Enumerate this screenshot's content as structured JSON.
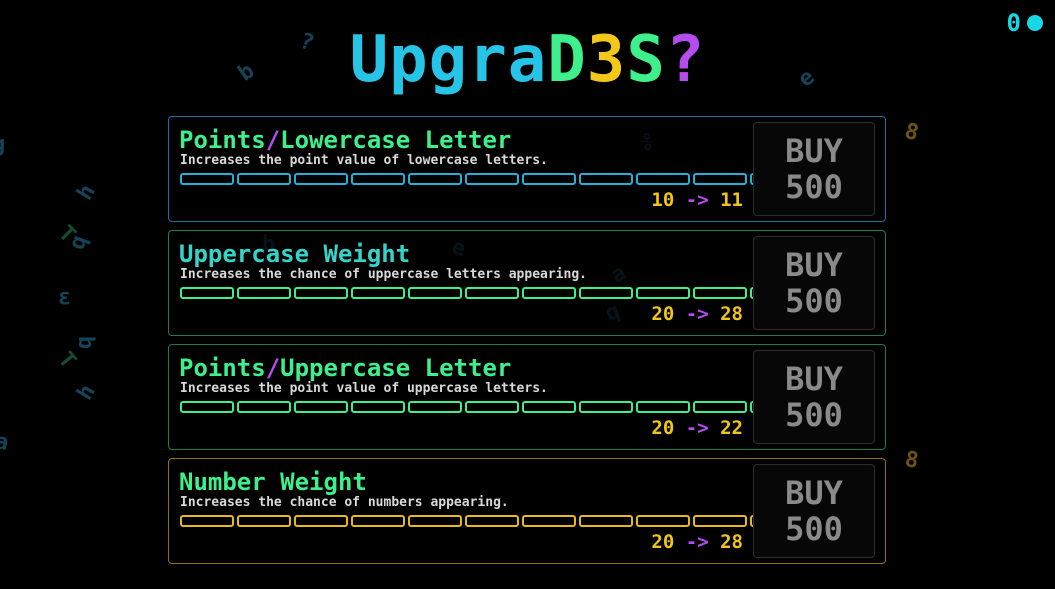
{
  "points": {
    "value": "0",
    "color": "#18d8e8"
  },
  "title": {
    "segments": [
      {
        "text": "Upgra",
        "color": "#26c4e6"
      },
      {
        "text": "D",
        "color": "#3ef08c"
      },
      {
        "text": "3",
        "color": "#f3c81b"
      },
      {
        "text": "S",
        "color": "#3ef08c"
      },
      {
        "text": "?",
        "color": "#b44cf0"
      }
    ]
  },
  "upgrades": [
    {
      "name_parts": [
        {
          "text": "Points",
          "color": "#3ef08c"
        },
        {
          "text": "/",
          "color": "#b44cf0"
        },
        {
          "text": "Lowercase Letter",
          "color": "#3ef08c"
        }
      ],
      "description": "Increases the point value of lowercase letters.",
      "border_color": "#1f6fa0",
      "bar_color": "#26b0d8",
      "level_segments": 11,
      "current_value": "10",
      "arrow": "->",
      "next_value": "11",
      "buy_label": "BUY",
      "cost": "500"
    },
    {
      "name_parts": [
        {
          "text": "Uppercase Weight",
          "color": "#34d4c8"
        }
      ],
      "description": "Increases the chance of uppercase letters appearing.",
      "border_color": "#1f7a5a",
      "bar_color": "#3ef08c",
      "level_segments": 11,
      "current_value": "20",
      "arrow": "->",
      "next_value": "28",
      "buy_label": "BUY",
      "cost": "500"
    },
    {
      "name_parts": [
        {
          "text": "Points",
          "color": "#3ef08c"
        },
        {
          "text": "/",
          "color": "#b44cf0"
        },
        {
          "text": "Uppercase Letter",
          "color": "#3ef08c"
        }
      ],
      "description": "Increases the point value of uppercase letters.",
      "border_color": "#1f7a4a",
      "bar_color": "#3ef08c",
      "level_segments": 11,
      "current_value": "20",
      "arrow": "->",
      "next_value": "22",
      "buy_label": "BUY",
      "cost": "500"
    },
    {
      "name_parts": [
        {
          "text": "Number Weight",
          "color": "#3ef08c"
        }
      ],
      "description": "Increases the chance of numbers appearing.",
      "border_color": "#8a7314",
      "bar_color": "#e8b91a",
      "level_segments": 11,
      "current_value": "20",
      "arrow": "->",
      "next_value": "28",
      "buy_label": "BUY",
      "cost": "500"
    }
  ],
  "background_glyphs": [
    {
      "char": "b",
      "color": "#2a7aa0"
    },
    {
      "char": "?",
      "color": "#2a7aa0"
    },
    {
      "char": "e",
      "color": "#2a7aa0"
    },
    {
      "char": "8",
      "color": "#c89a1a"
    },
    {
      "char": "8",
      "color": "#c89a1a"
    },
    {
      "char": "h",
      "color": "#2a7aa0"
    },
    {
      "char": "T",
      "color": "#2a8a5a"
    },
    {
      "char": "q",
      "color": "#2a7aa0"
    },
    {
      "char": "ε",
      "color": "#2a7aa0"
    },
    {
      "char": "q",
      "color": "#2a7aa0"
    },
    {
      "char": "T",
      "color": "#2a8a5a"
    },
    {
      "char": "h",
      "color": "#2a7aa0"
    },
    {
      "char": "a",
      "color": "#2a7aa0"
    },
    {
      "char": "g",
      "color": "#2a7aa0"
    },
    {
      "char": "%",
      "color": "#7a3aa0"
    },
    {
      "char": "a",
      "color": "#2a7aa0"
    },
    {
      "char": "e",
      "color": "#2a7aa0"
    },
    {
      "char": "q",
      "color": "#2a7aa0"
    },
    {
      "char": "b",
      "color": "#2a7aa0"
    }
  ]
}
